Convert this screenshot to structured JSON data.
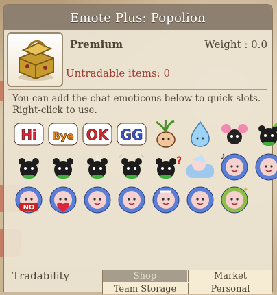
{
  "window": {
    "title": "Emote Plus: Popolion"
  },
  "item": {
    "grade": "Premium",
    "weight": "Weight : 0.0",
    "untradable": "Untradable items: 0",
    "description": "You can add the chat emoticons below to quick slots. Right-click to use.",
    "icon": "golden-chest-icon"
  },
  "emoticons": [
    {
      "name": "hi-emote",
      "text": "Hi"
    },
    {
      "name": "bye-emote",
      "text": "Bye"
    },
    {
      "name": "ok-emote",
      "text": "OK"
    },
    {
      "name": "gg-emote",
      "text": "GG"
    },
    {
      "name": "onion-emote"
    },
    {
      "name": "water-spirit-emote"
    },
    {
      "name": "cheer-emote"
    },
    {
      "name": "bear-sprout-emote"
    },
    {
      "name": "bear-angry-emote"
    },
    {
      "name": "bear-sigh-emote"
    },
    {
      "name": "bear-horn-emote"
    },
    {
      "name": "bear-alarm-emote"
    },
    {
      "name": "bear-question-emote",
      "text": "?"
    },
    {
      "name": "sleep-emote"
    },
    {
      "name": "popolion-music-emote"
    },
    {
      "name": "popolion-smile-emote"
    },
    {
      "name": "popolion-no-emote",
      "text": "NO"
    },
    {
      "name": "popolion-love-emote"
    },
    {
      "name": "popolion-cry-emote"
    },
    {
      "name": "popolion-shock-emote"
    },
    {
      "name": "popolion-sick-emote"
    },
    {
      "name": "popolion-sad-emote"
    },
    {
      "name": "popolion-sparkle-emote"
    }
  ],
  "tradability": {
    "label": "Tradability",
    "shop": "Shop",
    "market": "Market",
    "team_storage": "Team Storage",
    "personal": "Personal"
  },
  "colors": {
    "title_bar": "#8e8070",
    "untradable": "#9b3a30",
    "shop_disabled": "#a79d8c"
  }
}
